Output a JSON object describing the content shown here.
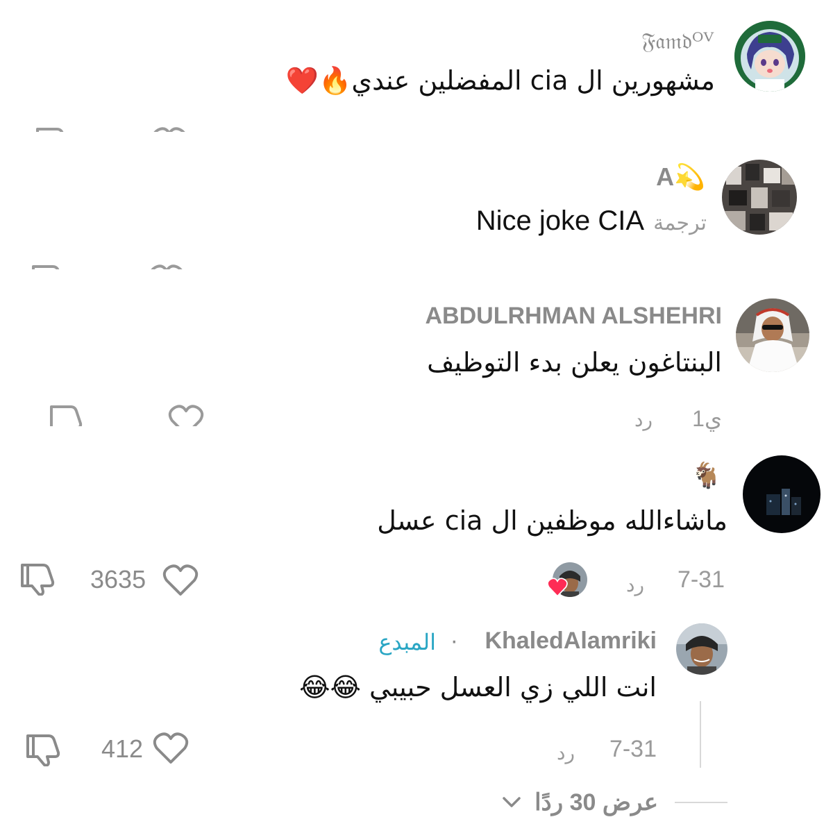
{
  "comments": [
    {
      "username": "𝔉𝔞𝔪𝔡ᴼⱽ",
      "text": "مشهورين ال cia المفضلين عندي🔥❤️"
    },
    {
      "username": "A💫",
      "translate_label": "ترجمة",
      "text": "Nice joke CIA"
    },
    {
      "username": "ABDULRHMAN ALSHEHRI",
      "text": "البنتاغون يعلن بدء التوظيف",
      "time": "1ي",
      "reply_label": "رد"
    },
    {
      "username": "🐐",
      "text": "ماشاءالله موظفين ال cia عسل",
      "time": "7-31",
      "reply_label": "رد",
      "likes": "3635"
    }
  ],
  "reply": {
    "username": "KhaledAlamriki",
    "separator": "·",
    "creator_badge": "المبدع",
    "text": "انت اللي زي العسل حبيبي 😂😂",
    "time": "7-31",
    "reply_label": "رد",
    "likes": "412"
  },
  "view_replies": {
    "label": "عرض 30 ردًا"
  },
  "icons": {
    "like": "heart-outline-icon",
    "dislike": "thumbs-down-icon",
    "expand": "chevron-down-icon",
    "liked_by_creator": "heart-filled-icon"
  },
  "colors": {
    "creator_badge": "#2aa6c4",
    "liked_heart": "#fe2c55",
    "muted_text": "#8a8a8a"
  }
}
